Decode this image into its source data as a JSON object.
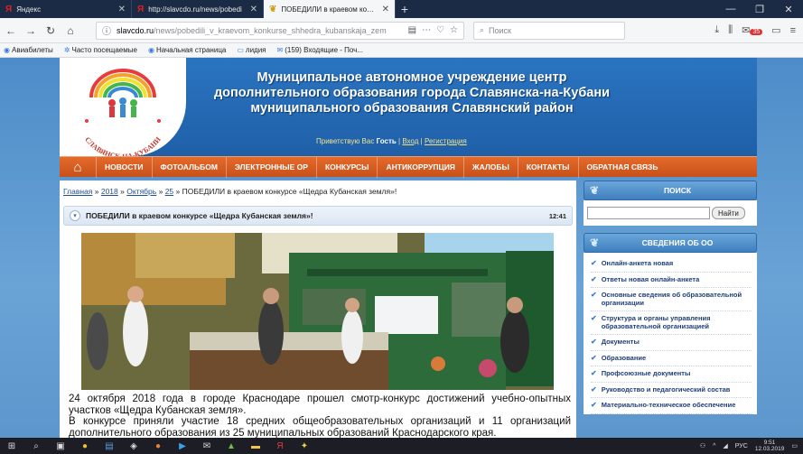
{
  "browser": {
    "tabs": [
      {
        "label": "Яндекс",
        "icon": "yandex-icon"
      },
      {
        "label": "http://slavcdo.ru/news/pobedi",
        "icon": "yandex-icon"
      },
      {
        "label": "ПОБЕДИЛИ в краевом конку",
        "icon": "site-icon"
      }
    ],
    "url_host": "slavcdo.ru",
    "url_path": "/news/pobedili_v_kraevom_konkurse_shhedra_kubanskaja_zem",
    "search_placeholder": "Поиск",
    "notification_count": "35",
    "bookmarks": [
      "Авиабилеты",
      "Часто посещаемые",
      "Начальная страница",
      "лидия",
      "(159) Входящие - Поч..."
    ]
  },
  "site": {
    "title_line1": "Муниципальное автономное учреждение центр",
    "title_line2": "дополнительного образования города Славянска-на-Кубани",
    "title_line3": "муниципального образования Славянский район",
    "greeting_prefix": "Приветствую Вас",
    "greeting_user": "Гость",
    "login_label": "Вход",
    "register_label": "Регистрация",
    "logo_text": "СЛАВЯНСК-НА-КУБАНИ"
  },
  "menu": [
    "НОВОСТИ",
    "ФОТОАЛЬБОМ",
    "ЭЛЕКТРОННЫЕ ОР",
    "КОНКУРСЫ",
    "АНТИКОРРУПЦИЯ",
    "ЖАЛОБЫ",
    "КОНТАКТЫ",
    "ОБРАТНАЯ СВЯЗЬ"
  ],
  "breadcrumbs": {
    "home": "Главная",
    "year": "2018",
    "month": "Октябрь",
    "day": "25",
    "current": "ПОБЕДИЛИ в краевом конкурсе «Щедра Кубанская земля»!",
    "sep": "»"
  },
  "news": {
    "title": "ПОБЕДИЛИ в краевом конкурсе «Щедра Кубанская земля»!",
    "time": "12:41",
    "paragraph1": "24 октября 2018 года в городе Краснодаре прошел смотр-конкурс достижений учебно-опытных участков «Щедра Кубанская земля».",
    "paragraph2": "В конкурсе приняли участие 18 средних общеобразовательных организаций и 11 организаций дополнительного образования из 25 муниципальных образований Краснодарского края."
  },
  "sidebar": {
    "search_title": "ПОИСК",
    "search_button": "Найти",
    "info_title": "СВЕДЕНИЯ ОБ ОО",
    "info_items": [
      "Онлайн-анкета новая",
      "Ответы новая онлайн-анкета",
      "Основные сведения об образовательной организации",
      "Структура и органы управления образовательной организацией",
      "Документы",
      "Образование",
      "Профсоюзные документы",
      "Руководство и педагогический состав",
      "Материально-техническое обеспечение"
    ]
  },
  "taskbar": {
    "lang": "РУС",
    "time": "9:51",
    "date": "12.03.2019"
  }
}
